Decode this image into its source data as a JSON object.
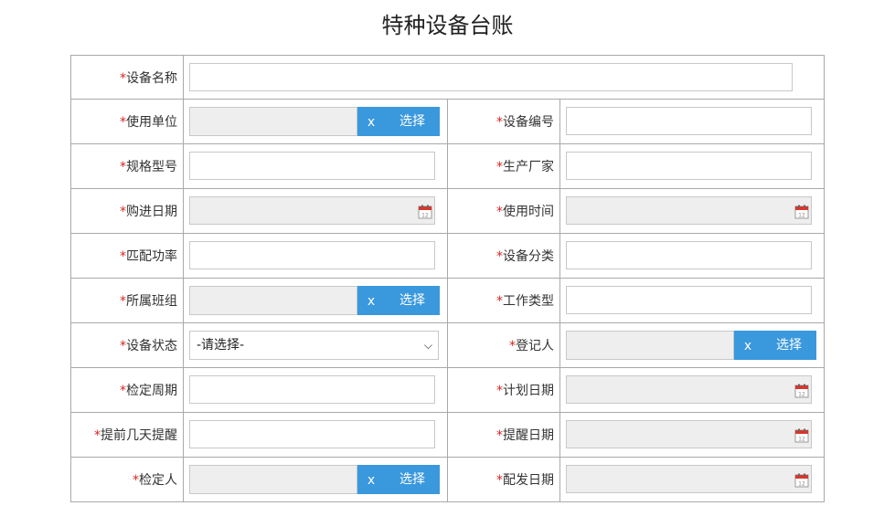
{
  "page": {
    "title": "特种设备台账"
  },
  "required_mark": "*",
  "select_label": "选择",
  "clear_label": "x",
  "fields": {
    "device_name": {
      "label": "设备名称",
      "value": ""
    },
    "use_unit": {
      "label": "使用单位",
      "value": ""
    },
    "device_no": {
      "label": "设备编号",
      "value": ""
    },
    "spec_model": {
      "label": "规格型号",
      "value": ""
    },
    "manufacturer": {
      "label": "生产厂家",
      "value": ""
    },
    "purchase_date": {
      "label": "购进日期",
      "value": ""
    },
    "use_time": {
      "label": "使用时间",
      "value": ""
    },
    "matched_power": {
      "label": "匹配功率",
      "value": ""
    },
    "device_category": {
      "label": "设备分类",
      "value": ""
    },
    "team": {
      "label": "所属班组",
      "value": ""
    },
    "work_type": {
      "label": "工作类型",
      "value": ""
    },
    "device_status": {
      "label": "设备状态",
      "selected": "-请选择-"
    },
    "registrant": {
      "label": "登记人",
      "value": ""
    },
    "inspection_cycle": {
      "label": "检定周期",
      "value": ""
    },
    "plan_date": {
      "label": "计划日期",
      "value": ""
    },
    "remind_days": {
      "label": "提前几天提醒",
      "value": ""
    },
    "remind_date": {
      "label": "提醒日期",
      "value": ""
    },
    "inspector": {
      "label": "检定人",
      "value": ""
    },
    "issue_date": {
      "label": "配发日期",
      "value": ""
    }
  }
}
